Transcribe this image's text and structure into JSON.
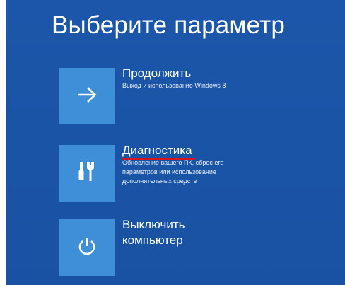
{
  "screen": {
    "title": "Выберите параметр",
    "background_color": "#1a55a8",
    "tile_color": "#3f8fd8"
  },
  "options": [
    {
      "label": "Продолжить",
      "description": "Выход и использование Windows 8",
      "icon": "arrow-right-icon"
    },
    {
      "label": "Диагностика",
      "description": "Обновление вашего ПК, сброс его параметров или использование дополнительных средств",
      "icon": "tools-icon",
      "annotation": "red-underline",
      "annotation_color": "#d8141c"
    },
    {
      "label_line1": "Выключить",
      "label_line2": "компьютер",
      "icon": "power-icon"
    }
  ]
}
